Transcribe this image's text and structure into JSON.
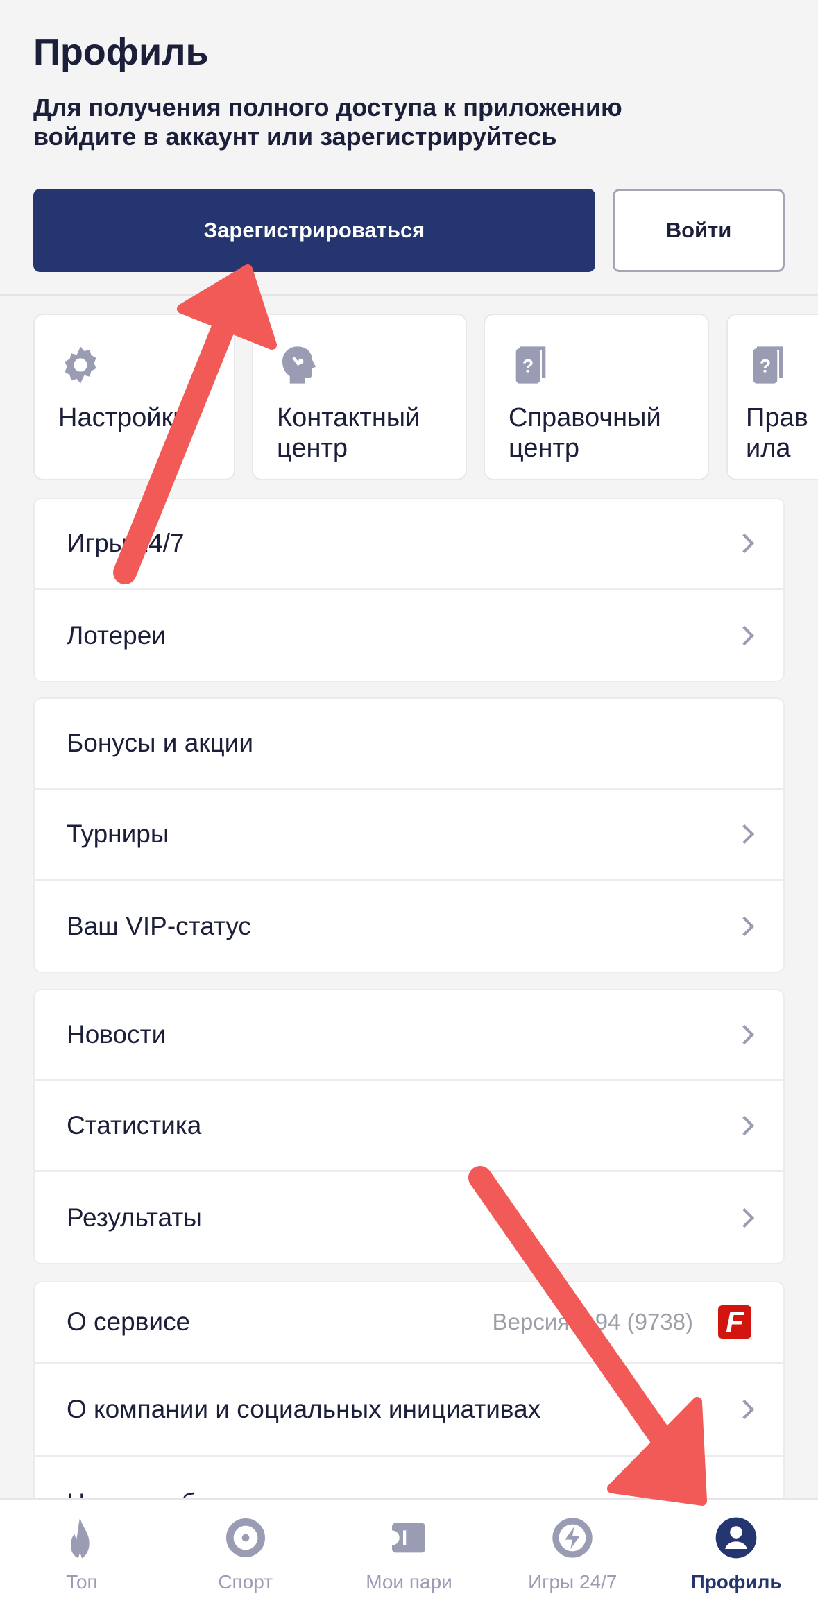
{
  "header": {
    "title": "Профиль",
    "subtitle": "Для получения полного доступа к приложению войдите в аккаунт или зарегистрируйтесь",
    "register_label": "Зарегистрироваться",
    "login_label": "Войти"
  },
  "tiles": [
    {
      "label": "Настройки",
      "icon": "gear-icon"
    },
    {
      "label": "Контактный центр",
      "icon": "head-support-icon"
    },
    {
      "label": "Справочный центр",
      "icon": "help-book-icon"
    },
    {
      "label": "Правила",
      "icon": "help-book-icon"
    }
  ],
  "groups": [
    [
      {
        "label": "Игры 24/7"
      },
      {
        "label": "Лотереи"
      }
    ],
    [
      {
        "label": "Бонусы и акции"
      },
      {
        "label": "Турниры"
      },
      {
        "label": "Ваш VIP-статус"
      }
    ],
    [
      {
        "label": "Новости"
      },
      {
        "label": "Статистика"
      },
      {
        "label": "Результаты"
      }
    ],
    [
      {
        "label": "О сервисе",
        "version": "Версия 7.94 (9738)",
        "logo": "F"
      },
      {
        "label": "О компании и социальных инициативах"
      },
      {
        "label": "Наши клубы"
      }
    ]
  ],
  "nav": [
    {
      "label": "Топ",
      "icon": "flame-icon"
    },
    {
      "label": "Спорт",
      "icon": "target-icon"
    },
    {
      "label": "Мои пари",
      "icon": "ticket-icon"
    },
    {
      "label": "Игры 24/7",
      "icon": "lightning-icon"
    },
    {
      "label": "Профиль",
      "icon": "user-icon",
      "active": true
    }
  ],
  "colors": {
    "primary": "#24356f",
    "text": "#1c1f3a",
    "icon": "#9a9cb4",
    "annotation_arrow": "#f25a57"
  }
}
